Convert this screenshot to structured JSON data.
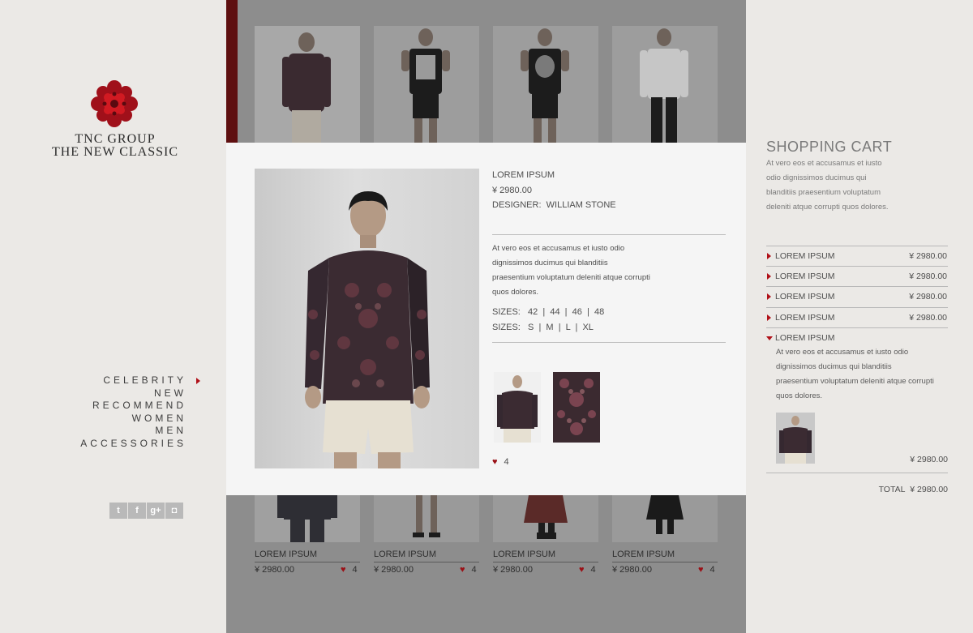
{
  "brand": {
    "line1": "TNC GROUP",
    "line2": "THE NEW CLASSIC"
  },
  "nav": {
    "items": [
      "CELEBRITY",
      "NEW",
      "RECOMMEND",
      "WOMEN",
      "MEN",
      "ACCESSORIES"
    ],
    "active": "CELEBRITY"
  },
  "social": {
    "twitter": "t",
    "facebook": "f",
    "google_plus": "g+",
    "instagram": "◘"
  },
  "gallery": {
    "bottom": [
      {
        "name": "LOREM IPSUM",
        "price": "¥ 2980.00",
        "likes": "4"
      },
      {
        "name": "LOREM IPSUM",
        "price": "¥ 2980.00",
        "likes": "4"
      },
      {
        "name": "LOREM IPSUM",
        "price": "¥ 2980.00",
        "likes": "4"
      },
      {
        "name": "LOREM IPSUM",
        "price": "¥ 2980.00",
        "likes": "4"
      }
    ]
  },
  "product": {
    "name": "LOREM IPSUM",
    "price": "¥ 2980.00",
    "designer_label": "DESIGNER:",
    "designer": "WILLIAM STONE",
    "desc1": "At vero eos et accusamus et iusto odio",
    "desc2": "dignissimos ducimus qui blanditiis",
    "desc3": "praesentium voluptatum deleniti atque corrupti",
    "desc4": "quos dolores.",
    "sizes_label": "SIZES:",
    "sizes_num": "42  |  44  |  46  |  48",
    "sizes_letter": "S  |  M  |  L  |  XL",
    "likes": "4"
  },
  "cart": {
    "title": "SHOPPING CART",
    "desc1": "At vero eos et accusamus et iusto",
    "desc2": "odio dignissimos ducimus qui",
    "desc3": "blanditiis praesentium voluptatum",
    "desc4": "deleniti atque corrupti quos dolores.",
    "items": [
      {
        "name": "LOREM IPSUM",
        "price": "¥ 2980.00"
      },
      {
        "name": "LOREM IPSUM",
        "price": "¥ 2980.00"
      },
      {
        "name": "LOREM IPSUM",
        "price": "¥ 2980.00"
      },
      {
        "name": "LOREM IPSUM",
        "price": "¥ 2980.00"
      }
    ],
    "expanded": {
      "name": "LOREM IPSUM",
      "desc1": "At vero eos et accusamus et iusto odio",
      "desc2": "dignissimos ducimus qui blanditiis",
      "desc3": "praesentium voluptatum deleniti atque corrupti",
      "desc4": "quos dolores.",
      "price": "¥ 2980.00"
    },
    "total_label": "TOTAL",
    "total": "¥ 2980.00"
  },
  "colors": {
    "accent": "#b01018",
    "dark_red": "#5e0f10",
    "overlay": "#8d8d8d",
    "panel": "#f5f5f5"
  }
}
